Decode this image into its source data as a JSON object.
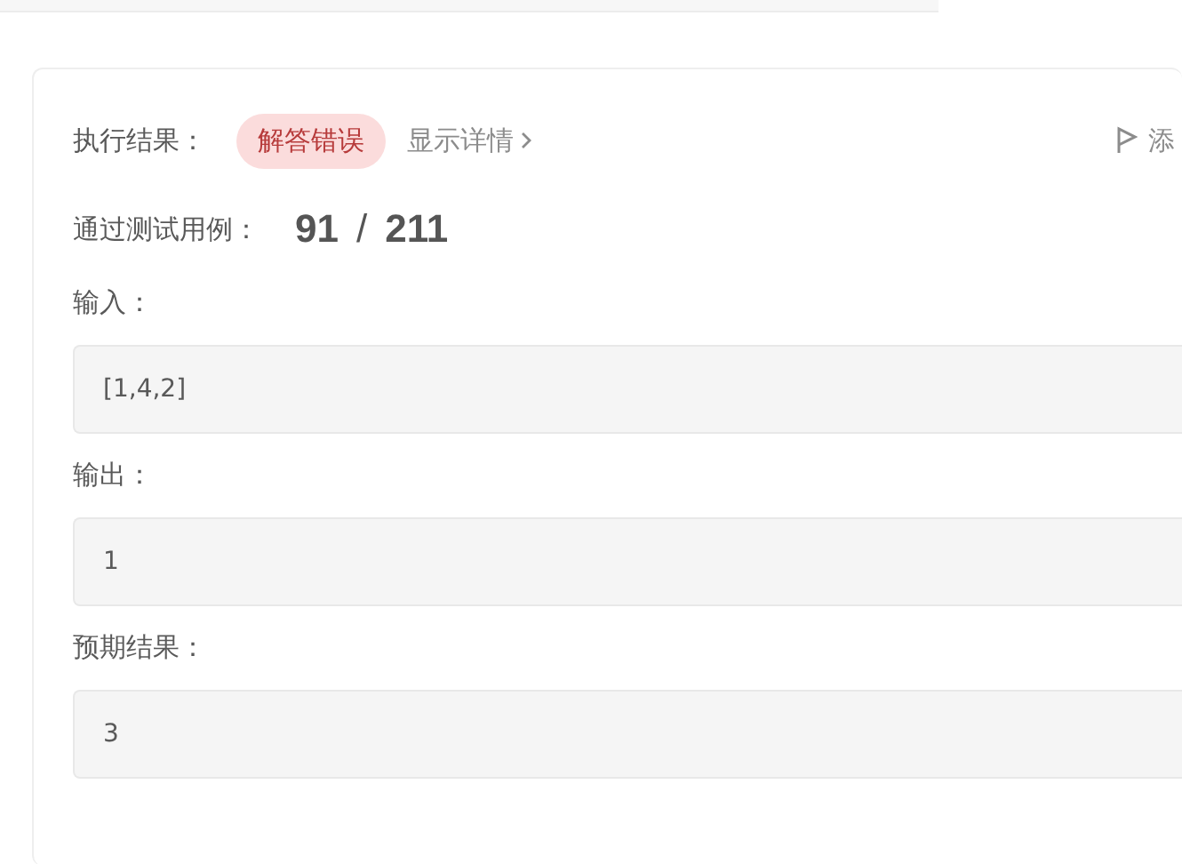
{
  "result": {
    "label": "执行结果：",
    "verdict": {
      "text": "解答错误",
      "kind": "error"
    },
    "details_link": "显示详情",
    "action": "添"
  },
  "passed": {
    "label": "通过测试用例：",
    "passed": "91",
    "separator": "/",
    "total": "211"
  },
  "fields": [
    {
      "label": "输入：",
      "value": "[1,4,2]"
    },
    {
      "label": "输出：",
      "value": "1"
    },
    {
      "label": "预期结果：",
      "value": "3"
    }
  ]
}
